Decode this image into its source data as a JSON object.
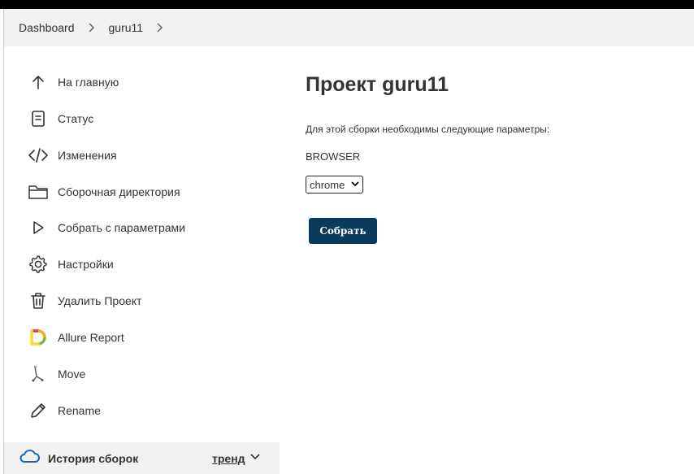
{
  "breadcrumb": {
    "items": [
      "Dashboard",
      "guru11"
    ]
  },
  "sidebar": {
    "items": [
      {
        "label": "На главную",
        "icon": "arrow-up-icon"
      },
      {
        "label": "Статус",
        "icon": "document-icon"
      },
      {
        "label": "Изменения",
        "icon": "code-icon"
      },
      {
        "label": "Сборочная директория",
        "icon": "folder-icon"
      },
      {
        "label": "Собрать с параметрами",
        "icon": "play-icon"
      },
      {
        "label": "Настройки",
        "icon": "gear-icon"
      },
      {
        "label": "Удалить Проект",
        "icon": "trash-icon"
      },
      {
        "label": "Allure Report",
        "icon": "allure-logo-icon"
      },
      {
        "label": "Move",
        "icon": "move-icon"
      },
      {
        "label": "Rename",
        "icon": "pencil-icon"
      }
    ]
  },
  "history": {
    "label": "История сборок",
    "trend": "тренд",
    "icon": "cloud-icon"
  },
  "main": {
    "title": "Проект guru11",
    "description": "Для этой сборки необходимы следующие параметры:",
    "param_name": "BROWSER",
    "param_value": "chrome",
    "build_button": "Собрать"
  },
  "colors": {
    "button_bg": "#0a3b5a",
    "breadcrumb_bg": "#f2f1f1",
    "text": "#333333"
  }
}
